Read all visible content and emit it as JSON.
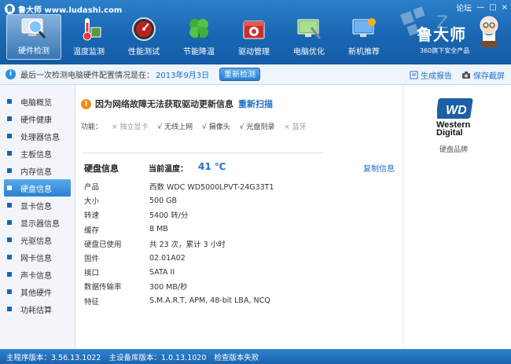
{
  "window": {
    "title": "鲁大师 www.ludashi.com",
    "forum": "论坛",
    "controls": [
      "—",
      "□",
      "×"
    ]
  },
  "toolbar": {
    "tools": [
      {
        "label": "硬件检测",
        "icon": "magnifier-monitor-icon",
        "active": true
      },
      {
        "label": "温度监测",
        "icon": "thermometer-icon",
        "active": false
      },
      {
        "label": "性能测试",
        "icon": "speedometer-icon",
        "active": false
      },
      {
        "label": "节能降温",
        "icon": "clover-icon",
        "active": false
      },
      {
        "label": "驱动管理",
        "icon": "toolbox-icon",
        "active": false
      },
      {
        "label": "电脑优化",
        "icon": "desktop-wrench-icon",
        "active": false
      },
      {
        "label": "新机推荐",
        "icon": "new-pc-icon",
        "active": false
      }
    ]
  },
  "brand": {
    "name": "鲁大师",
    "tagline": "360旗下安全产品"
  },
  "infobar": {
    "message": "最后一次检测电脑硬件配置情况是在：",
    "date": "2013年9月3日",
    "recheck": "重新检测",
    "report": "生成报告",
    "screenshot": "保存截屏"
  },
  "sidebar": {
    "items": [
      {
        "label": "电脑概览",
        "active": false
      },
      {
        "label": "硬件健康",
        "active": false
      },
      {
        "label": "处理器信息",
        "active": false
      },
      {
        "label": "主板信息",
        "active": false
      },
      {
        "label": "内存信息",
        "active": false
      },
      {
        "label": "硬盘信息",
        "active": true
      },
      {
        "label": "显卡信息",
        "active": false
      },
      {
        "label": "显示器信息",
        "active": false
      },
      {
        "label": "光驱信息",
        "active": false
      },
      {
        "label": "网卡信息",
        "active": false
      },
      {
        "label": "声卡信息",
        "active": false
      },
      {
        "label": "其他硬件",
        "active": false
      },
      {
        "label": "功耗估算",
        "active": false
      }
    ]
  },
  "main": {
    "warning": "因为网络故障无法获取驱动更新信息",
    "rescan": "重新扫描",
    "features_label": "功能：",
    "features": [
      {
        "mark": "×",
        "label": "独立显卡",
        "on": false
      },
      {
        "mark": "√",
        "label": "无线上网",
        "on": true
      },
      {
        "mark": "√",
        "label": "摄像头",
        "on": true
      },
      {
        "mark": "√",
        "label": "光盘刻录",
        "on": true
      },
      {
        "mark": "×",
        "label": "蓝牙",
        "on": false
      }
    ],
    "disk_title": "硬盘信息",
    "temp_label": "当前温度：",
    "temp_value": "41 ℃",
    "copy": "复制信息",
    "rows": [
      {
        "k": "产品",
        "v": "西数 WDC WD5000LPVT-24G33T1"
      },
      {
        "k": "大小",
        "v": "500 GB"
      },
      {
        "k": "转速",
        "v": "5400 转/分"
      },
      {
        "k": "缓存",
        "v": "8 MB"
      },
      {
        "k": "硬盘已使用",
        "v": "共 23 次，累计 3 小时"
      },
      {
        "k": "固件",
        "v": "02.01A02"
      },
      {
        "k": "接口",
        "v": "SATA II"
      },
      {
        "k": "数据传输率",
        "v": "300 MB/秒"
      },
      {
        "k": "特征",
        "v": "S.M.A.R.T, APM, 48-bit LBA, NCQ"
      }
    ]
  },
  "rpanel": {
    "logo_mono": "WD",
    "logo_line1": "Western",
    "logo_line2": "Digital",
    "caption": "硬盘品牌"
  },
  "statusbar": {
    "main_version": "主程序版本：3.56.13.1022",
    "db_version": "主设备库版本：1.0.13.1020",
    "update": "检查版本失败"
  }
}
